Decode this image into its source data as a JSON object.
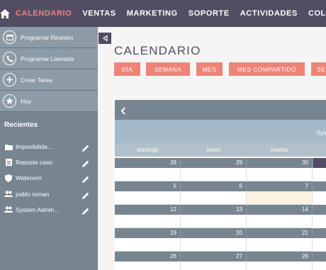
{
  "topnav": {
    "home_icon": "home-icon",
    "items": [
      "CALENDARIO",
      "VENTAS",
      "MARKETING",
      "SOPORTE",
      "ACTIVIDADES",
      "COLABORACIÓN"
    ],
    "active_color": "#f08377"
  },
  "sidebar": {
    "actions": [
      {
        "label": "Programar Reunión",
        "icon": "calendar-icon"
      },
      {
        "label": "Programar Llamada",
        "icon": "phone-icon"
      },
      {
        "label": "Crear Tarea",
        "icon": "plus-icon"
      },
      {
        "label": "Hoy",
        "icon": "star-icon"
      }
    ],
    "recent_title": "Recientes",
    "recent": [
      {
        "label": "Imposibilida...",
        "icon": "folder-icon"
      },
      {
        "label": "Reposte caso",
        "icon": "document-icon"
      },
      {
        "label": "Webroom",
        "icon": "shield-icon"
      },
      {
        "label": "pablo roman",
        "icon": "users-icon"
      },
      {
        "label": "System Admin...",
        "icon": "users-icon"
      }
    ]
  },
  "main": {
    "title": "CALENDARIO",
    "buttons": [
      "DÍA",
      "SEMANA",
      "MES",
      "MES COMPARTIDO",
      "SE"
    ],
    "subheader_text": "Sys",
    "days_of_week": [
      "domingo",
      "lunes",
      "martes"
    ],
    "weeks": [
      [
        "28",
        "29",
        "30"
      ],
      [
        "5",
        "6",
        "7"
      ],
      [
        "12",
        "13",
        "14"
      ],
      [
        "19",
        "20",
        "21"
      ],
      [
        "26",
        "27",
        "28"
      ]
    ]
  },
  "colors": {
    "nav_bg": "#534d64",
    "accent": "#f08377",
    "sidebar_bg": "#778591",
    "calendar_header": "#778591",
    "calendar_subheader": "#a4b9c9"
  }
}
